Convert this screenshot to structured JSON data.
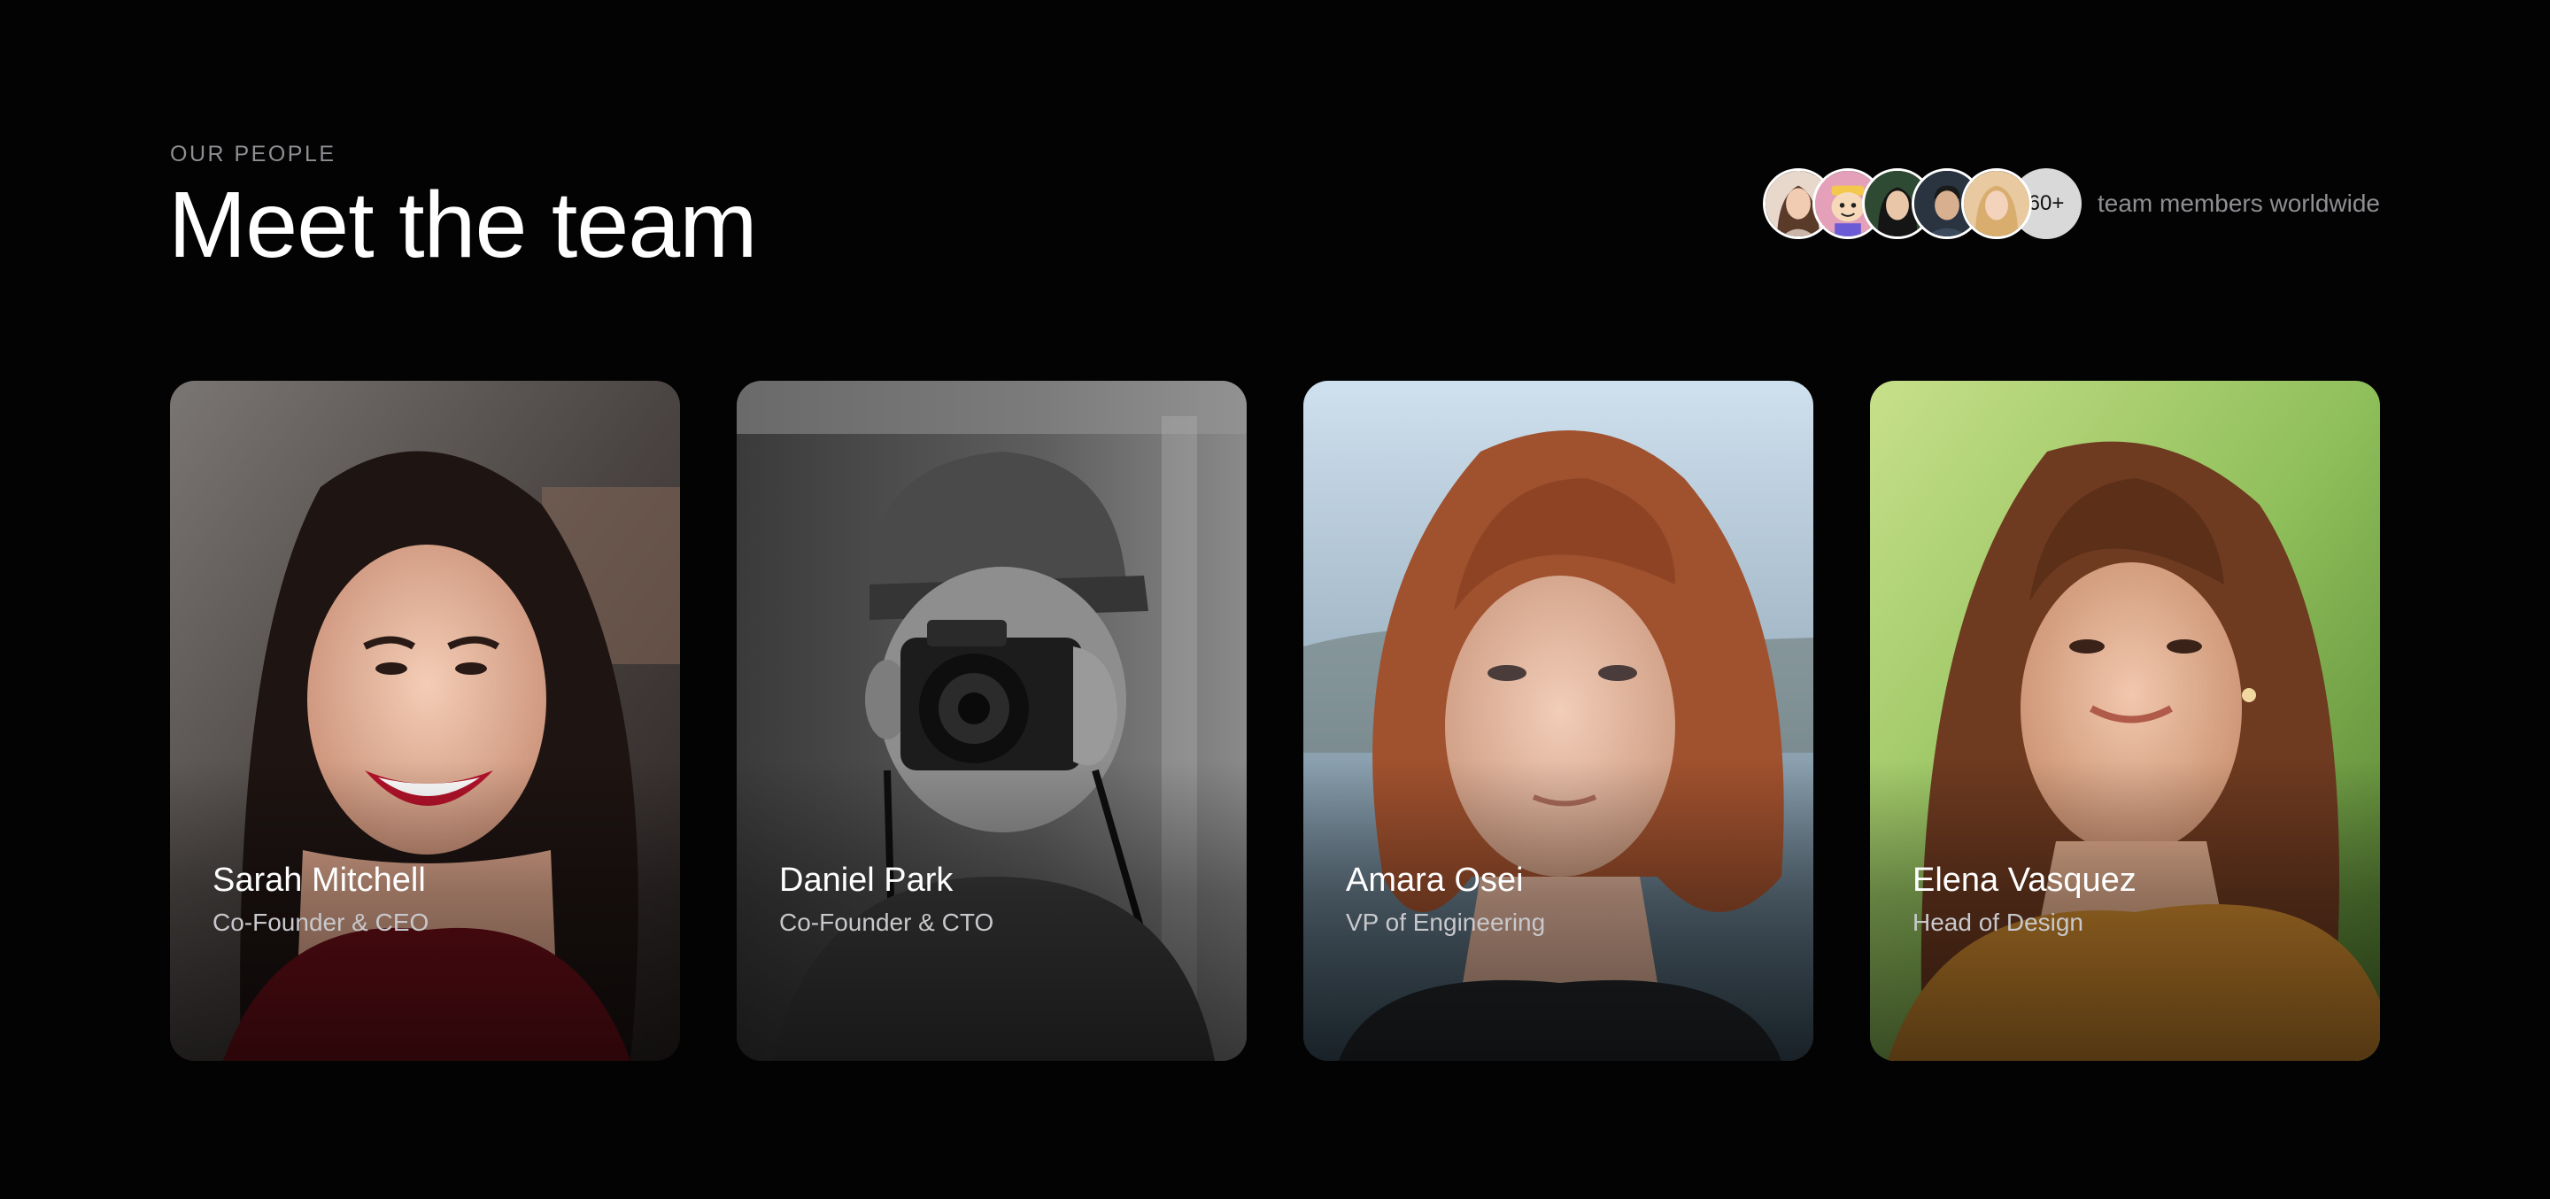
{
  "header": {
    "eyebrow": "OUR PEOPLE",
    "title": "Meet the team"
  },
  "team_count": {
    "more_label": "60+",
    "label": "team members worldwide",
    "avatars": [
      {
        "icon": "woman-portrait-avatar",
        "bg": "#e8d8cc"
      },
      {
        "icon": "cartoon-character-avatar",
        "bg": "#e3a0b8"
      },
      {
        "icon": "woman-portrait-avatar",
        "bg": "#2f4a32"
      },
      {
        "icon": "man-portrait-avatar",
        "bg": "#2a3440"
      },
      {
        "icon": "woman-portrait-avatar",
        "bg": "#e8c9a0"
      }
    ]
  },
  "members": [
    {
      "name": "Sarah Mitchell",
      "role": "Co-Founder & CEO",
      "photo": "smiling-woman-dark-hair-red-top"
    },
    {
      "name": "Daniel Park",
      "role": "Co-Founder & CTO",
      "photo": "man-cap-holding-camera-bw"
    },
    {
      "name": "Amara Osei",
      "role": "VP of Engineering",
      "photo": "red-haired-woman-portrait"
    },
    {
      "name": "Elena Vasquez",
      "role": "Head of Design",
      "photo": "woman-auburn-hair-green-background"
    }
  ],
  "colors": {
    "background": "#030303",
    "text_primary": "#ffffff",
    "text_muted": "#8e8e93"
  }
}
